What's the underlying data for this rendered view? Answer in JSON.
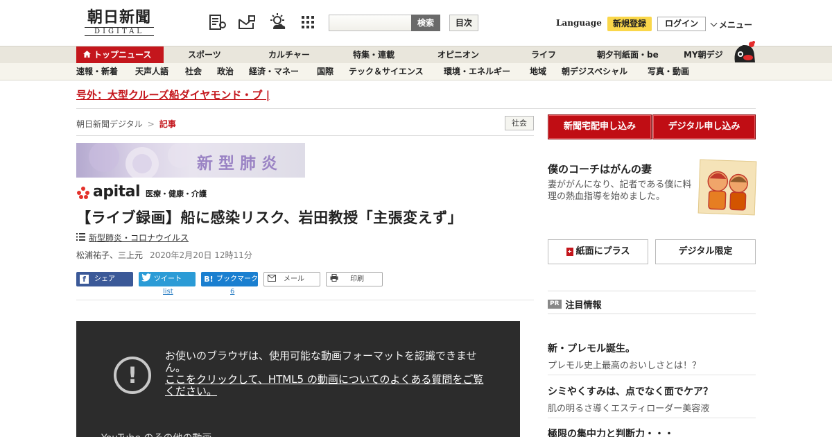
{
  "header": {
    "logo_jp": "朝日新聞",
    "logo_en": "DIGITAL",
    "search_button": "検索",
    "index_button": "目次",
    "language": "Language",
    "register": "新規登録",
    "login": "ログイン",
    "menu": "メニュー"
  },
  "nav_primary": [
    "トップニュース",
    "スポーツ",
    "カルチャー",
    "特集・連載",
    "オピニオン",
    "ライフ",
    "朝夕刊紙面・be",
    "MY朝デジ"
  ],
  "nav_secondary": [
    "速報・新着",
    "天声人語",
    "社会",
    "政治",
    "経済・マネー",
    "国際",
    "テック＆サイエンス",
    "環境・エネルギー",
    "地域",
    "朝デジスペシャル",
    "写真・動画"
  ],
  "breaking": "号外：大型クルーズ船ダイヤモンド・プ |",
  "breadcrumb": {
    "home": "朝日新聞デジタル",
    "sep": ">",
    "current": "記事"
  },
  "section_tag": "社会",
  "banner_text": "新型肺炎",
  "apital": {
    "word": "apital",
    "sub": "医療・健康・介護"
  },
  "article": {
    "headline": "【ライブ録画】船に感染リスク、岩田教授「主張変えず」",
    "topic": "新型肺炎・コロナウイルス",
    "authors": "松浦祐子、三上元",
    "date": "2020年2月20日 12時11分"
  },
  "share": {
    "facebook": "シェア",
    "twitter": "ツイート",
    "hatena": "ブックマーク",
    "mail": "メール",
    "print": "印刷",
    "twitter_count": "list",
    "hatena_count": "6"
  },
  "video": {
    "message": "お使いのブラウザは、使用可能な動画フォーマットを認識できません。",
    "link": "ここをクリックして、HTML5 の動画についてのよくある質問をご覧ください。",
    "more": "YouTube のその他の動画"
  },
  "sidebar": {
    "subscribe_paper": "新聞宅配申し込み",
    "subscribe_digital": "デジタル申し込み",
    "promo_title": "僕のコーチはがんの妻",
    "promo_desc": "妻ががんになり、記者である僕に料理の熱血指導を始めました。",
    "paper_plus": "紙面にプラス",
    "digital_only": "デジタル限定",
    "pr_badge": "PR",
    "pr_title": "注目情報",
    "ads": [
      {
        "title": "新・プレモル誕生。",
        "desc": "プレモル史上最高のおいしさとは！？"
      },
      {
        "title": "シミやくすみは、点でなく面でケア？",
        "desc": "肌の明るさ導くエスティローダー美容液"
      },
      {
        "title": "極限の集中力と判断力・・・",
        "desc": ""
      }
    ]
  },
  "colors": {
    "brand_red": "#c4161c",
    "register_yellow": "#fad74a",
    "video_bg": "#2c2c2c"
  }
}
